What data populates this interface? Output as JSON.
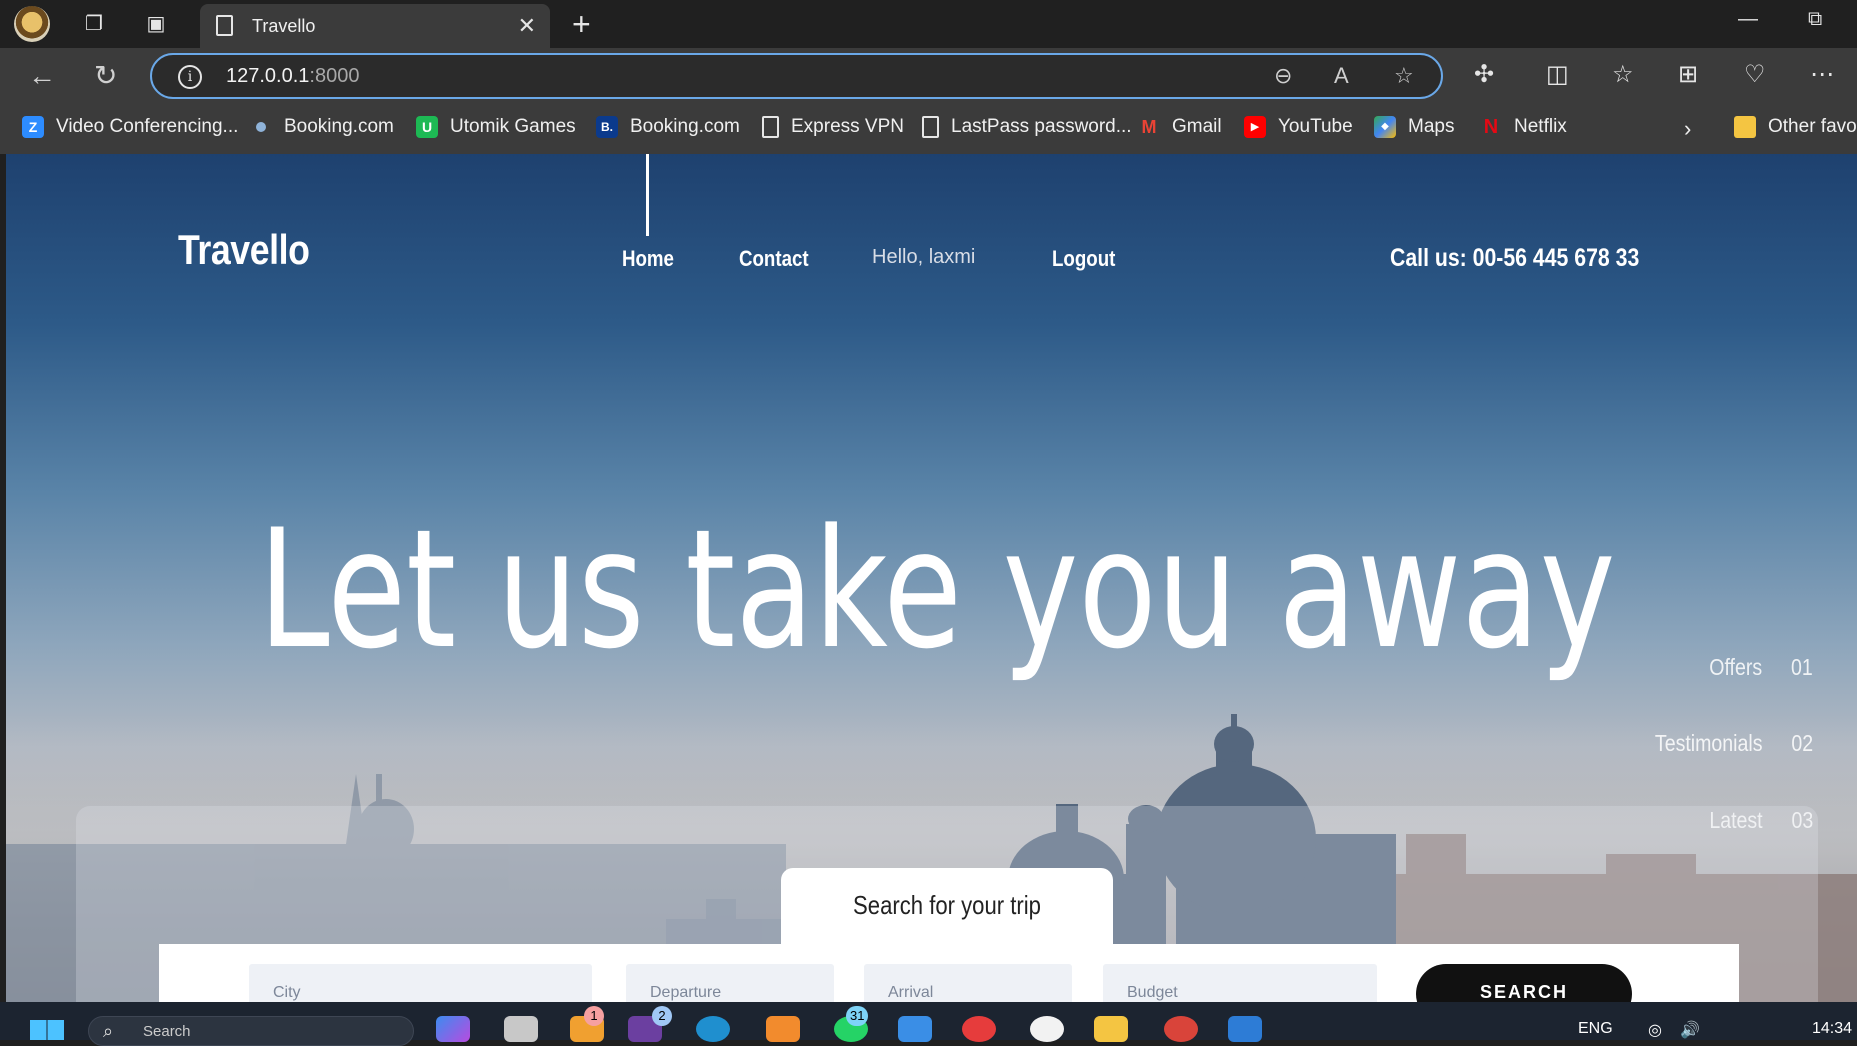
{
  "browser": {
    "tab": {
      "title": "Travello"
    },
    "address": {
      "host": "127.0.0.1",
      "port": ":8000"
    },
    "bookmarks": [
      {
        "label": "Video Conferencing...",
        "icon": "zoom-icon",
        "color": "#2d8cff",
        "glyph": "Z"
      },
      {
        "label": "Booking.com",
        "icon": "dot-icon",
        "color": "#8fb3d9",
        "glyph": ""
      },
      {
        "label": "Utomik Games",
        "icon": "utomik-icon",
        "color": "#1db954",
        "glyph": "U"
      },
      {
        "label": "Booking.com",
        "icon": "booking-icon",
        "color": "#0b3a8c",
        "glyph": "B."
      },
      {
        "label": "Express VPN",
        "icon": "document-icon",
        "color": "",
        "glyph": ""
      },
      {
        "label": "LastPass password...",
        "icon": "document-icon",
        "color": "",
        "glyph": ""
      },
      {
        "label": "Gmail",
        "icon": "gmail-icon",
        "color": "#ea4335",
        "glyph": "M"
      },
      {
        "label": "YouTube",
        "icon": "youtube-icon",
        "color": "#ff0000",
        "glyph": "▶"
      },
      {
        "label": "Maps",
        "icon": "maps-icon",
        "color": "#34a853",
        "glyph": "◆"
      },
      {
        "label": "Netflix",
        "icon": "netflix-icon",
        "color": "#e50914",
        "glyph": "N"
      }
    ],
    "other_favorites": "Other favou"
  },
  "site": {
    "logo": "Travello",
    "nav": {
      "home": "Home",
      "contact": "Contact",
      "greeting": "Hello, laxmi",
      "logout": "Logout"
    },
    "call_us": "Call us: 00-56 445 678 33",
    "hero_title": "Let us take you away",
    "side_nav": [
      {
        "label": "Offers",
        "num": "01"
      },
      {
        "label": "Testimonials",
        "num": "02"
      },
      {
        "label": "Latest",
        "num": "03"
      }
    ],
    "search": {
      "tab_label": "Search for your trip",
      "fields": [
        "City",
        "Departure",
        "Arrival",
        "Budget"
      ],
      "button": "SEARCH"
    }
  },
  "taskbar": {
    "search_placeholder": "Search",
    "badges": {
      "mail": "1",
      "teams": "2",
      "whatsapp": "31"
    },
    "language": "ENG",
    "time": "14:34"
  }
}
